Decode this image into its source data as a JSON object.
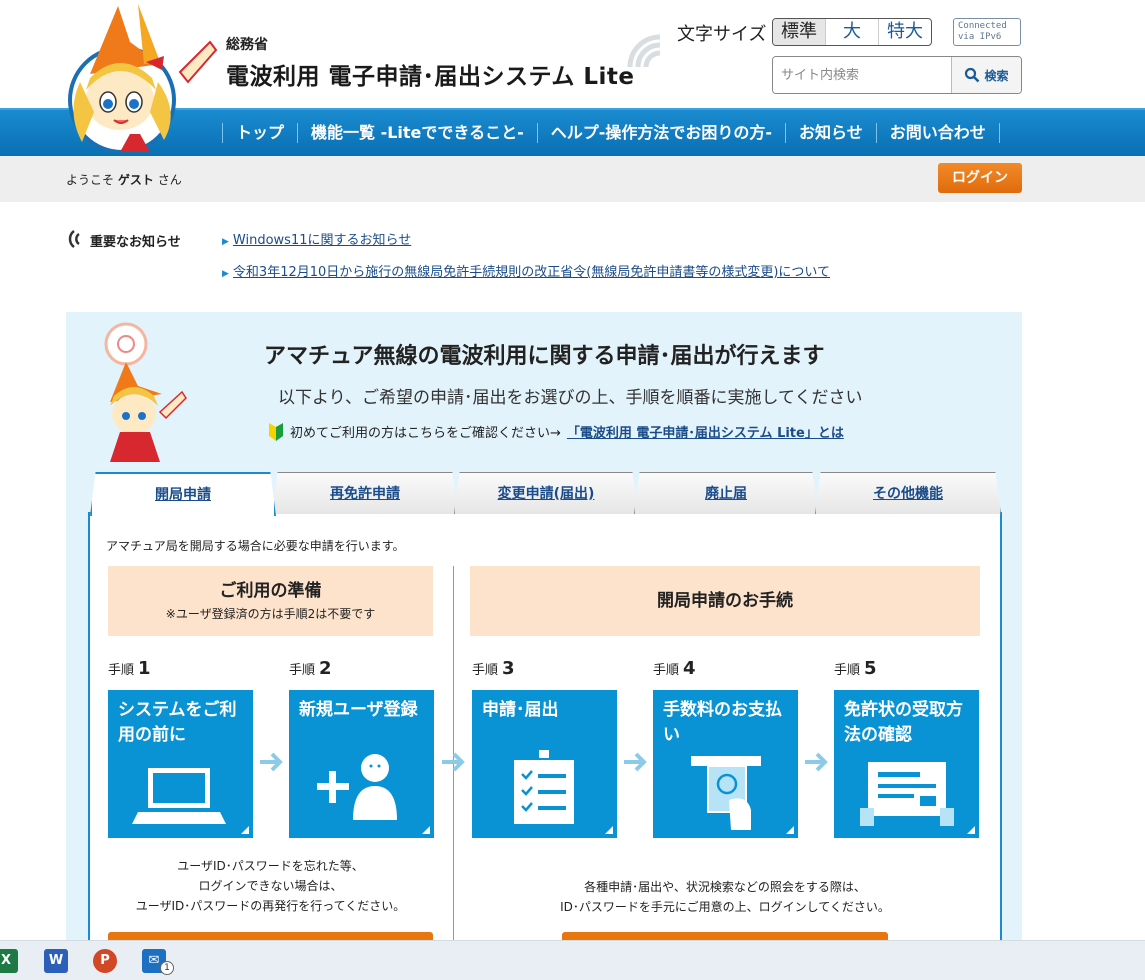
{
  "header": {
    "agency": "総務省",
    "title": "電波利用 電子申請･届出システム Lite",
    "font_size_label": "文字サイズ",
    "font_sizes": [
      "標準",
      "大",
      "特大"
    ],
    "ipv6_line1": "Connected",
    "ipv6_line2": "via IPv6",
    "search_placeholder": "サイト内検索",
    "search_button": "検索"
  },
  "nav": {
    "items": [
      "トップ",
      "機能一覧 -Liteでできること-",
      "ヘルプ-操作方法でお困りの方-",
      "お知らせ",
      "お問い合わせ"
    ]
  },
  "welcome": {
    "prefix": "ようこそ",
    "user": "ゲスト",
    "suffix": "さん",
    "login": "ログイン"
  },
  "notices": {
    "label": "重要なお知らせ",
    "items": [
      "Windows11に関するお知らせ",
      "令和3年12月10日から施行の無線局免許手続規則の改正省令(無線局免許申請書等の様式変更)について"
    ]
  },
  "main": {
    "title": "アマチュア無線の電波利用に関する申請･届出が行えます",
    "subtitle": "以下より、ご希望の申請･届出をお選びの上、手順を順番に実施してください",
    "first_time_text": "初めてご利用の方はこちらをご確認ください→",
    "first_time_link": "「電波利用 電子申請･届出システム Lite」とは",
    "tabs": [
      "開局申請",
      "再免許申請",
      "変更申請(届出)",
      "廃止届",
      "その他機能"
    ],
    "tab_description": "アマチュア局を開局する場合に必要な申請を行います。",
    "prep_title": "ご利用の準備",
    "prep_note": "※ユーザ登録済の方は手順2は不要です",
    "procedure_title": "開局申請のお手続",
    "step_word": "手順",
    "steps": [
      {
        "num": "1",
        "label": "システムをご利用の前に"
      },
      {
        "num": "2",
        "label": "新規ユーザ登録"
      },
      {
        "num": "3",
        "label": "申請･届出"
      },
      {
        "num": "4",
        "label": "手数料のお支払い"
      },
      {
        "num": "5",
        "label": "免許状の受取方法の確認"
      }
    ],
    "help_left": [
      "ユーザID･パスワードを忘れた等、",
      "ログインできない場合は、",
      "ユーザID･パスワードの再発行を行ってください。"
    ],
    "help_right": [
      "各種申請･届出や、状況検索などの照会をする際は、",
      "ID･パスワードを手元にご用意の上、ログインしてください。"
    ]
  },
  "taskbar": {
    "mail_badge": "1"
  },
  "colors": {
    "nav_blue": "#0a6fb3",
    "step_blue": "#0a93d4",
    "login_orange": "#e8760f",
    "section_peach": "#fde2cc",
    "panel_bg": "#e3f3fb"
  }
}
